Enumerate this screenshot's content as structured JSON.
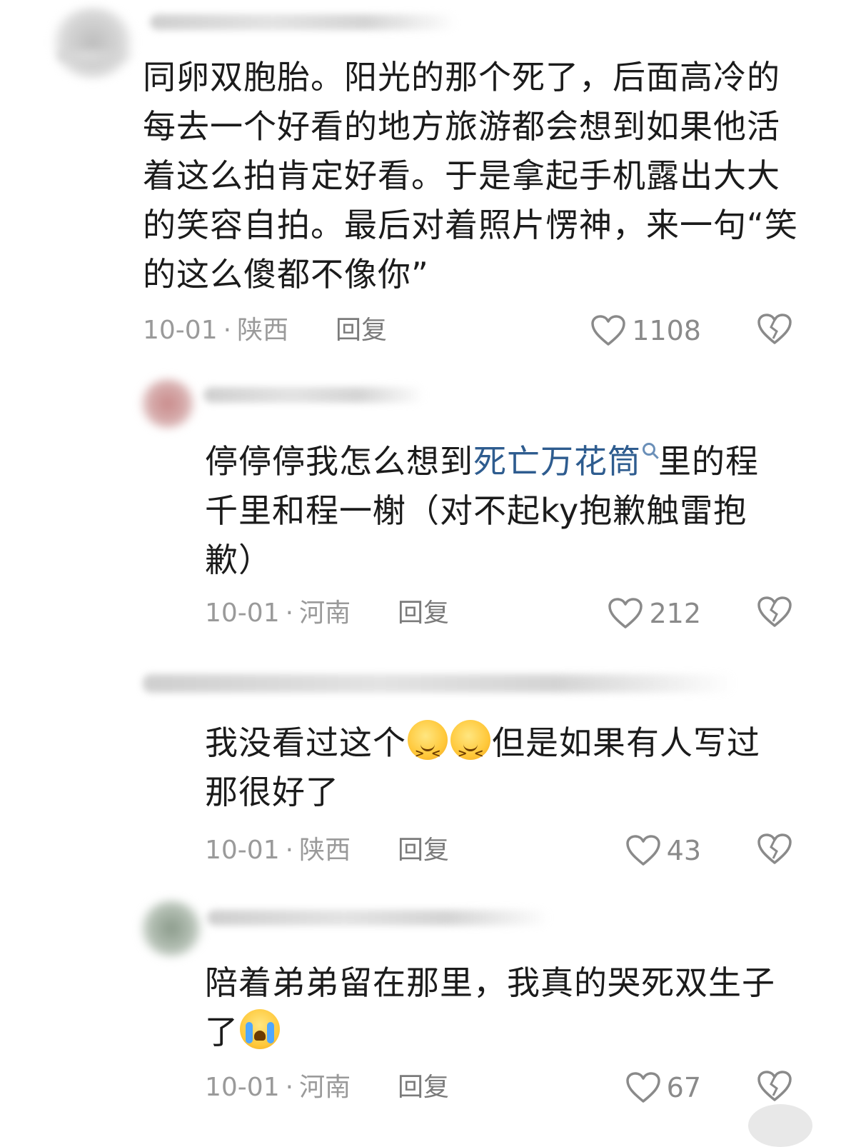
{
  "comments": [
    {
      "text_lines": [
        "同卵双胞胎。阳光的那个死了，后面高冷的",
        "每去一个好看的地方旅游都会想到如果他活",
        "着这么拍肯定好看。于是拿起手机露出大大",
        "的笑容自拍。最后对着照片愣神，来一句“笑",
        "的这么傻都不像你”"
      ],
      "date": "10-01",
      "location": "陕西",
      "reply_label": "回复",
      "likes": "1108"
    },
    {
      "segments_line1": {
        "before": "停停停我怎么想到",
        "link": "死亡万花筒",
        "after": "里的程"
      },
      "text_lines_rest": [
        "千里和程一榭（对不起ky抱歉触雷抱",
        "歉）"
      ],
      "date": "10-01",
      "location": "河南",
      "reply_label": "回复",
      "likes": "212"
    },
    {
      "line1_before": "我没看过这个",
      "line1_after": "但是如果有人写过",
      "line2": "那很好了",
      "date": "10-01",
      "location": "陕西",
      "reply_label": "回复",
      "likes": "43"
    },
    {
      "line1": "陪着弟弟留在那里，我真的哭死双生子",
      "line2": "了",
      "date": "10-01",
      "location": "河南",
      "reply_label": "回复",
      "likes": "67"
    }
  ],
  "colors": {
    "text": "#1b1b1b",
    "meta": "#9a9a9a",
    "link": "#2e5c8f"
  },
  "icons": {
    "like": "heart-outline-icon",
    "dislike": "broken-heart-icon",
    "emoji_smile": "smiling-emoji-icon",
    "emoji_cry": "crying-emoji-icon",
    "search": "search-icon"
  }
}
